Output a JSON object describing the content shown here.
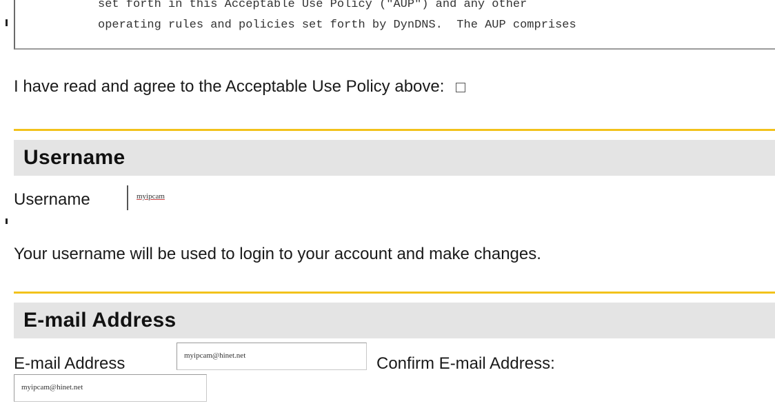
{
  "policy": {
    "lines": [
      "set forth in this Acceptable Use Policy (\"AUP\") and any other",
      "operating rules and policies set forth by DynDNS.  The AUP comprises"
    ]
  },
  "agree": {
    "label": "I have read and agree to the Acceptable Use Policy above:",
    "checked": false
  },
  "username_section": {
    "title": "Username",
    "field_label": "Username",
    "value": "myipcam",
    "help": "Your username will be used to login to your account and make changes."
  },
  "email_section": {
    "title": "E-mail Address",
    "field_label": "E-mail Address",
    "value": "myipcam@hinet.net",
    "confirm_label": "Confirm E-mail Address:",
    "confirm_value": "myipcam@hinet.net"
  },
  "colors": {
    "section_rule": "#f2c21b",
    "section_bg": "#e4e4e4"
  }
}
